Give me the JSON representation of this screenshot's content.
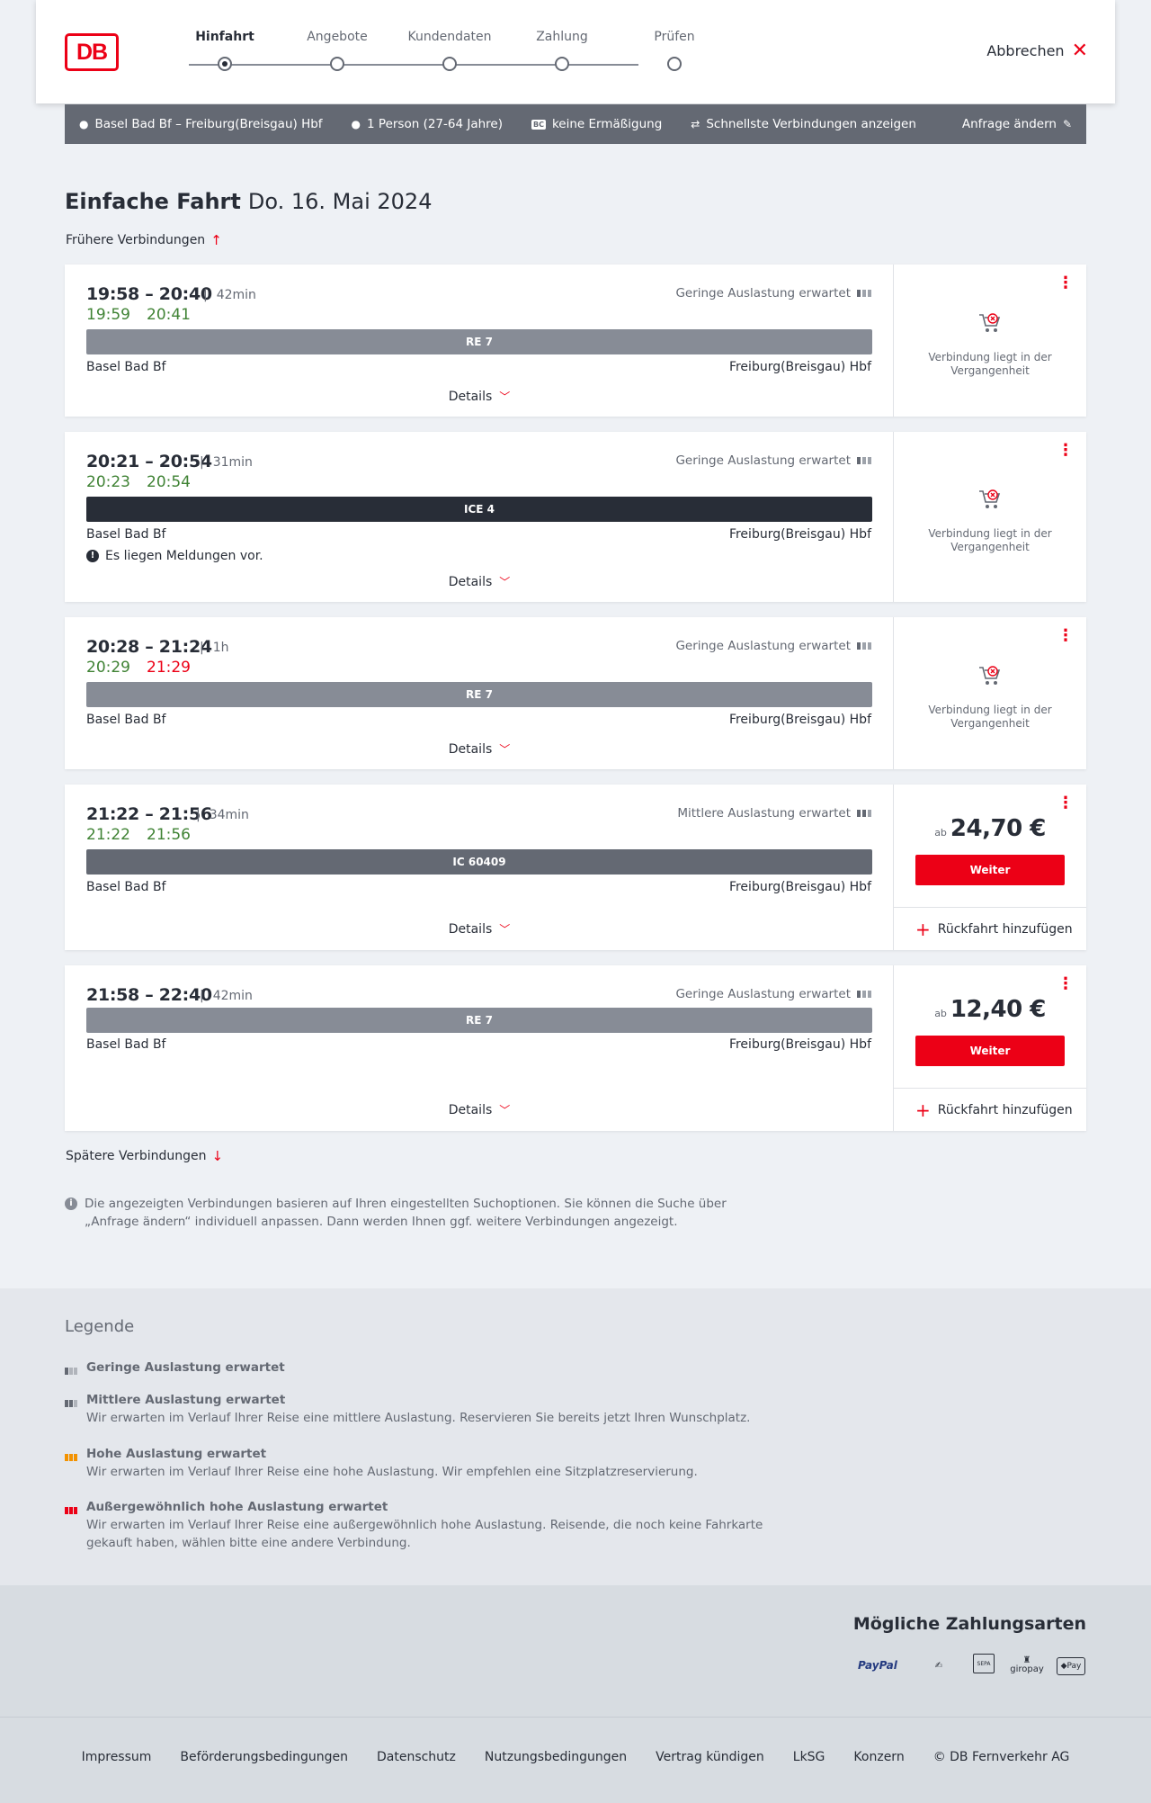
{
  "header": {
    "logo": "DB",
    "steps": [
      "Hinfahrt",
      "Angebote",
      "Kundendaten",
      "Zahlung",
      "Prüfen"
    ],
    "cancel_label": "Abbrechen"
  },
  "searchbar": {
    "route": "Basel Bad Bf – Freiburg(Breisgau) Hbf",
    "persons": "1 Person (27-64 Jahre)",
    "bc_badge": "BC",
    "discount": "keine Ermäßigung",
    "fastest": "Schnellste Verbindungen anzeigen",
    "change": "Anfrage ändern"
  },
  "title": {
    "type": "Einfache Fahrt",
    "date": "Do. 16. Mai 2024"
  },
  "earlier_label": "Frühere Verbindungen",
  "later_label": "Spätere Verbindungen",
  "details_label": "Details",
  "past_label": "Verbindung liegt in der Vergangenheit",
  "price_prefix": "ab",
  "weiter_label": "Weiter",
  "return_label": "Rückfahrt hinzufügen",
  "connections": [
    {
      "times": "19:58 – 20:40",
      "duration": "42min",
      "rt_dep": "19:59",
      "rt_arr": "20:41",
      "load": "Geringe Auslastung erwartet",
      "train": "RE 7",
      "from": "Basel Bad Bf",
      "to": "Freiburg(Breisgau) Hbf"
    },
    {
      "times": "20:21 – 20:54",
      "duration": "31min",
      "rt_dep": "20:23",
      "rt_arr": "20:54",
      "load": "Geringe Auslastung erwartet",
      "train": "ICE 4",
      "from": "Basel Bad Bf",
      "to": "Freiburg(Breisgau) Hbf",
      "message": "Es liegen Meldungen vor."
    },
    {
      "times": "20:28 – 21:24",
      "duration": "1h",
      "rt_dep": "20:29",
      "rt_arr": "21:29",
      "load": "Geringe Auslastung erwartet",
      "train": "RE 7",
      "from": "Basel Bad Bf",
      "to": "Freiburg(Breisgau) Hbf"
    },
    {
      "times": "21:22 – 21:56",
      "duration": "34min",
      "rt_dep": "21:22",
      "rt_arr": "21:56",
      "load": "Mittlere Auslastung erwartet",
      "train": "IC 60409",
      "from": "Basel Bad Bf",
      "to": "Freiburg(Breisgau) Hbf",
      "price": "24,70 €"
    },
    {
      "times": "21:58 – 22:40",
      "duration": "42min",
      "load": "Geringe Auslastung erwartet",
      "train": "RE 7",
      "from": "Basel Bad Bf",
      "to": "Freiburg(Breisgau) Hbf",
      "price": "12,40 €"
    }
  ],
  "notice": "Die angezeigten Verbindungen basieren auf Ihren eingestellten Suchoptionen. Sie können die Suche über „Anfrage ändern“ individuell anpassen. Dann werden Ihnen ggf. weitere Verbindungen angezeigt.",
  "legend": {
    "title": "Legende",
    "items": [
      {
        "title": "Geringe Auslastung erwartet",
        "text": ""
      },
      {
        "title": "Mittlere Auslastung erwartet",
        "text": "Wir erwarten im Verlauf Ihrer Reise eine mittlere Auslastung. Reservieren Sie bereits jetzt Ihren Wunschplatz."
      },
      {
        "title": "Hohe Auslastung erwartet",
        "text": "Wir erwarten im Verlauf Ihrer Reise eine hohe Auslastung. Wir empfehlen eine Sitzplatzreservierung."
      },
      {
        "title": "Außergewöhnlich hohe Auslastung erwartet",
        "text": "Wir erwarten im Verlauf Ihrer Reise eine außergewöhnlich hohe Auslastung. Reisende, die noch keine Fahrkarte gekauft haben, wählen bitte eine andere Verbindung."
      }
    ]
  },
  "payment": {
    "title": "Mögliche Zahlungsarten",
    "methods": [
      "PayPal",
      "SEPA",
      "giropay",
      "Pay"
    ]
  },
  "footer": [
    "Impressum",
    "Beförderungsbedingungen",
    "Datenschutz",
    "Nutzungsbedingungen",
    "Vertrag kündigen",
    "LkSG",
    "Konzern",
    "© DB Fernverkehr AG"
  ],
  "colors": {
    "brand": "#ec0016",
    "realtime_ok": "#408335",
    "realtime_late": "#ec0016"
  }
}
